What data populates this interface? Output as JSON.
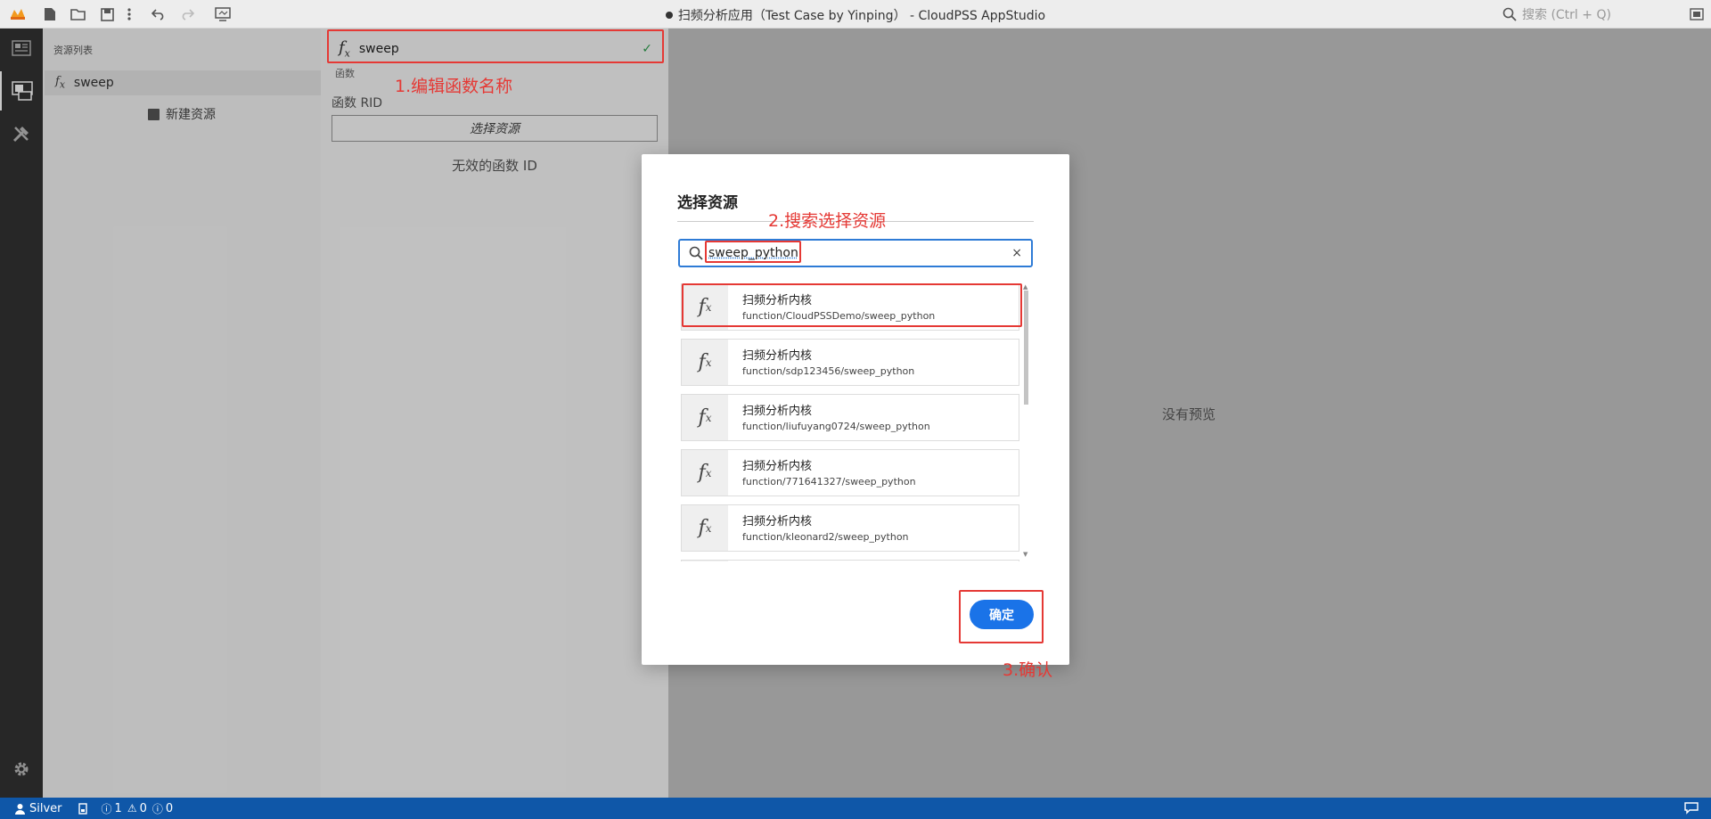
{
  "titlebar": {
    "title": "扫频分析应用（Test Case by Yinping） - CloudPSS AppStudio",
    "search_placeholder": "搜索 (Ctrl + Q)"
  },
  "sidepanel": {
    "title": "资源列表",
    "resource_name": "sweep",
    "new_resource": "新建资源"
  },
  "editor": {
    "name_value": "sweep",
    "function_caption": "函数",
    "rid_label": "函数 RID",
    "select_button": "选择资源",
    "invalid_id": "无效的函数 ID"
  },
  "preview": {
    "empty_text": "没有预览"
  },
  "modal": {
    "title": "选择资源",
    "search_value": "sweep_python",
    "clear_symbol": "×",
    "results": [
      {
        "name": "扫频分析内核",
        "path": "function/CloudPSSDemo/sweep_python"
      },
      {
        "name": "扫频分析内核",
        "path": "function/sdp123456/sweep_python"
      },
      {
        "name": "扫频分析内核",
        "path": "function/liufuyang0724/sweep_python"
      },
      {
        "name": "扫频分析内核",
        "path": "function/771641327/sweep_python"
      },
      {
        "name": "扫频分析内核",
        "path": "function/kleonard2/sweep_python"
      }
    ],
    "confirm": "确定"
  },
  "statusbar": {
    "user": "Silver",
    "errors": "1",
    "warnings": "0",
    "infos": "0"
  },
  "annotations": {
    "step1": "1.编辑函数名称",
    "step2": "2.搜索选择资源",
    "step3": "3.确认"
  },
  "colors": {
    "accent": "#1a73e8",
    "statusbar": "#0f57a8",
    "annotation": "#e53935",
    "check": "#2e9e4d"
  }
}
